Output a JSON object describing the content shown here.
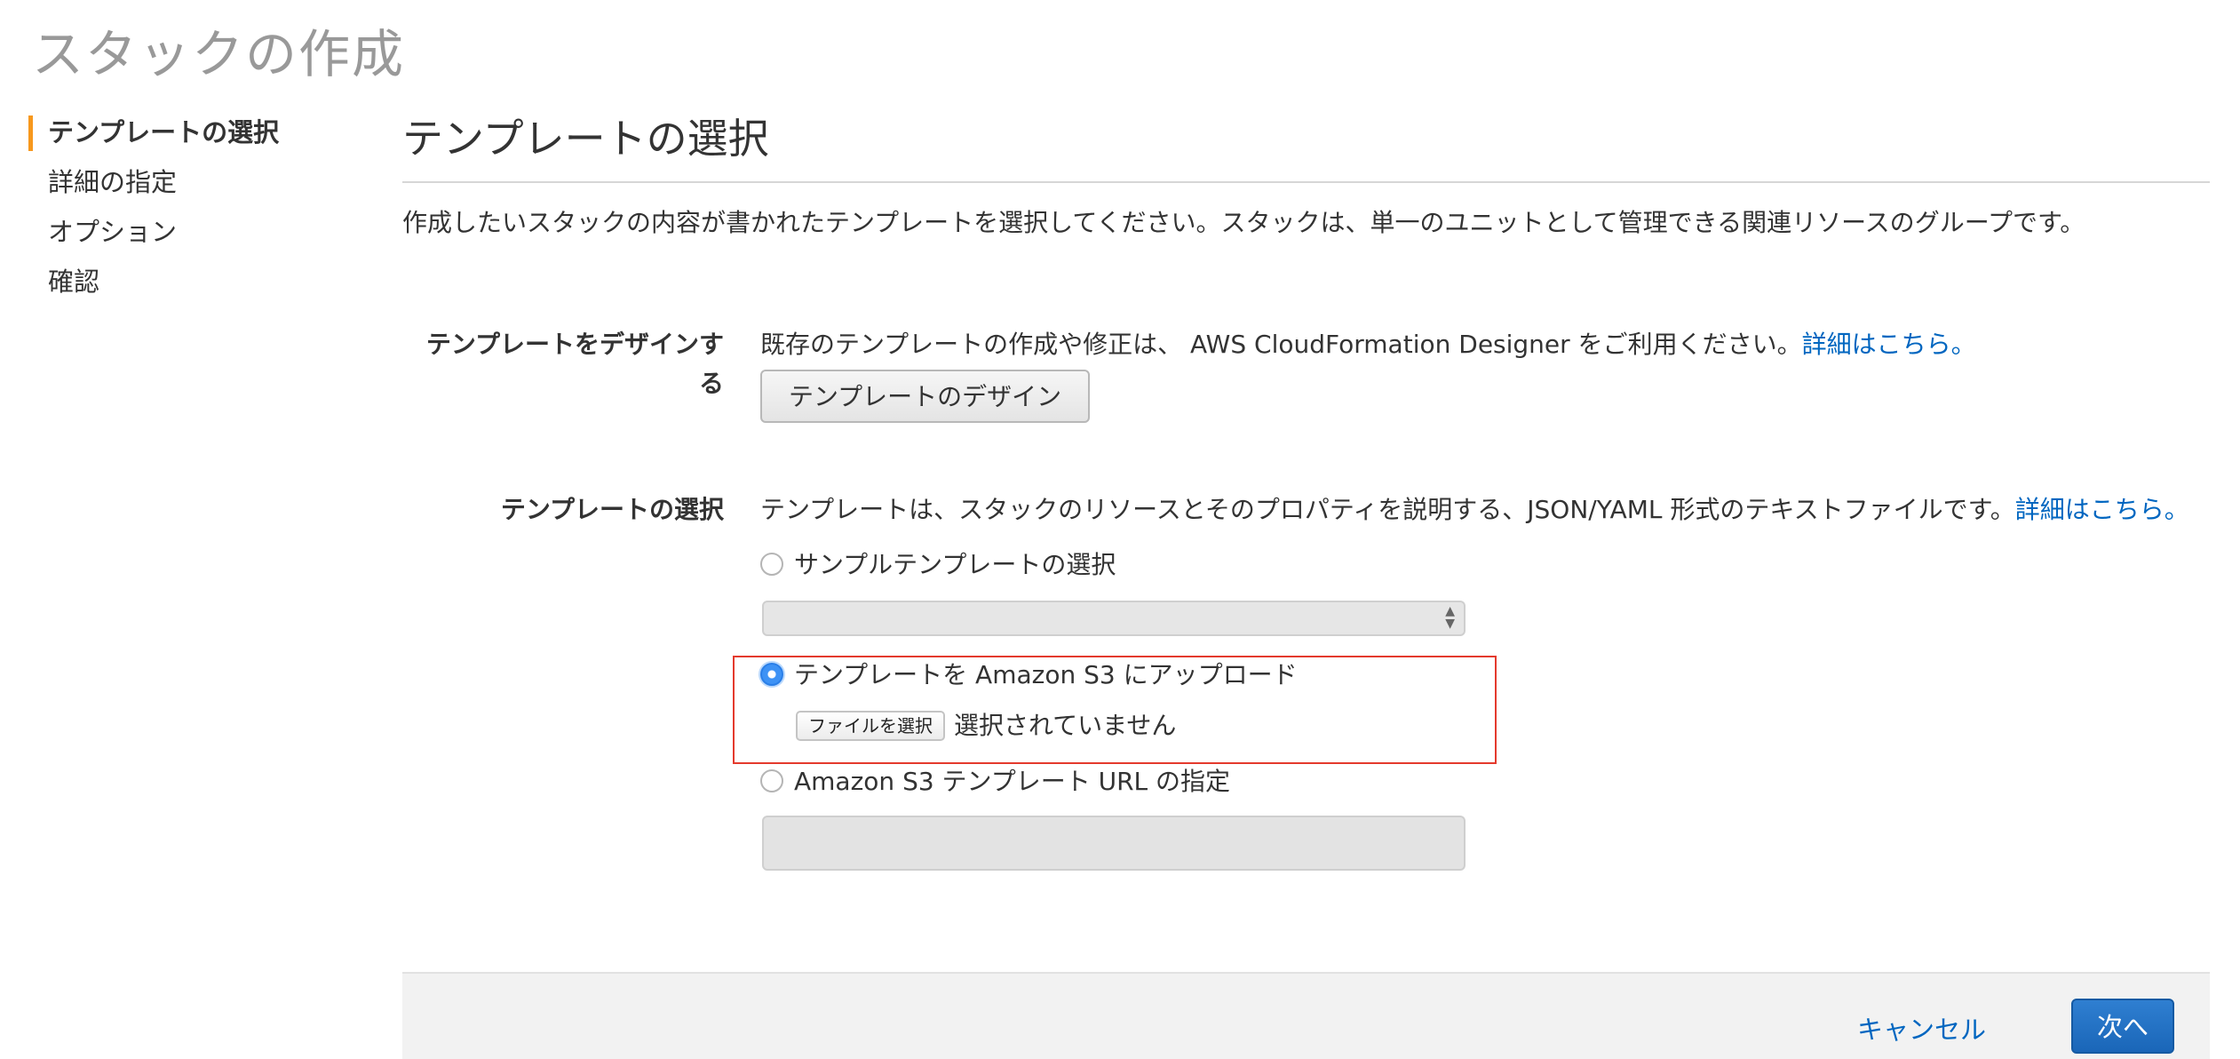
{
  "page": {
    "title": "スタックの作成"
  },
  "sidebar": {
    "steps": [
      {
        "label": "テンプレートの選択",
        "active": true
      },
      {
        "label": "詳細の指定",
        "active": false
      },
      {
        "label": "オプション",
        "active": false
      },
      {
        "label": "確認",
        "active": false
      }
    ]
  },
  "main": {
    "section_title": "テンプレートの選択",
    "intro": "作成したいスタックの内容が書かれたテンプレートを選択してください。スタックは、単一のユニットとして管理できる関連リソースのグループです。",
    "design": {
      "label": "テンプレートをデザインする",
      "description": "既存のテンプレートの作成や修正は、 AWS CloudFormation Designer をご利用ください。",
      "link": "詳細はこちら。",
      "button": "テンプレートのデザイン"
    },
    "choose": {
      "label": "テンプレートの選択",
      "description": "テンプレートは、スタックのリソースとそのプロパティを説明する、JSON/YAML 形式のテキストファイルです。",
      "link": "詳細はこちら。",
      "options": {
        "sample": "サンプルテンプレートの選択",
        "upload": "テンプレートを Amazon S3 にアップロード",
        "url": "Amazon S3 テンプレート URL の指定"
      },
      "selected_option": "upload",
      "file_button": "ファイルを選択",
      "file_status": "選択されていません",
      "sample_select_value": "",
      "url_value": ""
    }
  },
  "footer": {
    "cancel": "キャンセル",
    "next": "次へ"
  },
  "colors": {
    "accent": "#f7981d",
    "link": "#0066c0",
    "primary_button": "#1a66b8",
    "highlight": "#e43a2d"
  }
}
